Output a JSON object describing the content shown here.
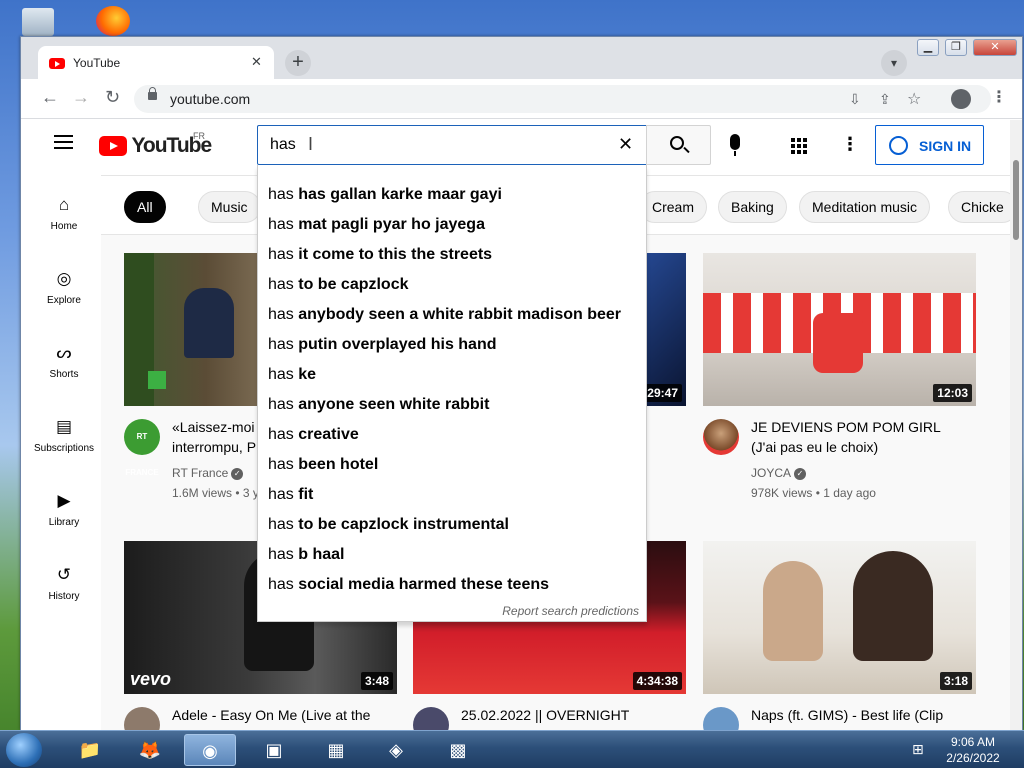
{
  "browser": {
    "tab_title": "YouTube",
    "tab_close": "✕",
    "new_tab": "+",
    "url": "youtube.com",
    "window_buttons": [
      "▁",
      "❐",
      "✕"
    ]
  },
  "youtube": {
    "logo_text": "YouTube",
    "region": "FR",
    "search_value": "has",
    "sign_in": "SIGN IN",
    "nav": [
      "Home",
      "Explore",
      "Shorts",
      "Subscriptions",
      "Library",
      "History"
    ],
    "chips": [
      "All",
      "Music",
      "Cream",
      "Baking",
      "Meditation music",
      "Chicke"
    ],
    "suggestions": [
      {
        "prefix": "has",
        "rest": "has gallan karke maar gayi"
      },
      {
        "prefix": "has",
        "rest": "mat pagli pyar ho jayega"
      },
      {
        "prefix": "has",
        "rest": "it come to this the streets"
      },
      {
        "prefix": "has",
        "rest": "to be capzlock"
      },
      {
        "prefix": "has",
        "rest": "anybody seen a white rabbit madison beer"
      },
      {
        "prefix": "has",
        "rest": "putin overplayed his hand"
      },
      {
        "prefix": "has",
        "rest": "ke"
      },
      {
        "prefix": "has",
        "rest": "anyone seen white rabbit"
      },
      {
        "prefix": "has",
        "rest": "creative"
      },
      {
        "prefix": "has",
        "rest": "been hotel"
      },
      {
        "prefix": "has",
        "rest": "fit"
      },
      {
        "prefix": "has",
        "rest": "to be capzlock instrumental"
      },
      {
        "prefix": "has",
        "rest": "b haal"
      },
      {
        "prefix": "has",
        "rest": "social media harmed these teens"
      }
    ],
    "report": "Report search predictions",
    "videos": [
      {
        "title": "«Laissez-moi ... interrompu, P",
        "title_l1": "«Laissez-moi",
        "title_l2": "interrompu, P",
        "channel": "RT France",
        "meta": "1.6M views • 3 y",
        "duration": ""
      },
      {
        "title": "",
        "channel": "",
        "meta": "",
        "duration": "29:47"
      },
      {
        "title_l1": "JE DEVIENS POM POM GIRL",
        "title_l2": "(J'ai pas eu le choix)",
        "channel": "JOYCA",
        "meta": "978K views • 1 day ago",
        "duration": "12:03"
      },
      {
        "title_l1": "Adele - Easy On Me (Live at the",
        "channel": "",
        "meta": "",
        "duration": "3:48"
      },
      {
        "title_l1": "25.02.2022 || OVERNIGHT",
        "channel": "",
        "meta": "",
        "duration": "4:34:38"
      },
      {
        "title_l1": "Naps (ft. GIMS) - Best life (Clip",
        "channel": "",
        "meta": "",
        "duration": "3:18"
      }
    ],
    "rt_label": "RT FRANCE",
    "vevo": "vevo"
  },
  "taskbar": {
    "time": "9:06 AM",
    "date": "2/26/2022"
  }
}
